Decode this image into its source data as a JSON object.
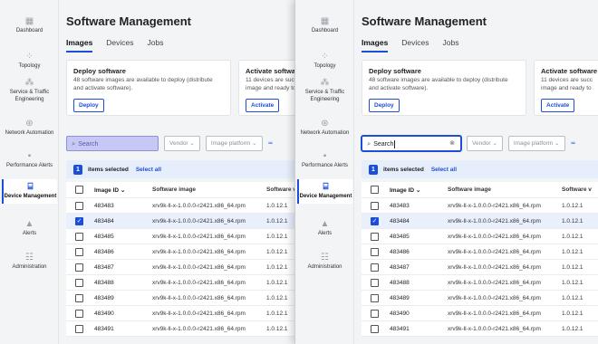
{
  "sidebar": {
    "items": [
      {
        "label": "Dashboard",
        "icon": "dashboard-icon",
        "glyph": "▦"
      },
      {
        "label": "Topology",
        "icon": "topology-icon",
        "glyph": "⁘"
      },
      {
        "label": "Service & Traffic Engineering",
        "icon": "service-icon",
        "glyph": "⁂"
      },
      {
        "label": "Network Automation",
        "icon": "automation-icon",
        "glyph": "⊛"
      },
      {
        "label": "Performance Alerts",
        "icon": "performance-icon",
        "glyph": "▪"
      },
      {
        "label": "Device Management",
        "icon": "device-icon",
        "glyph": "⌸"
      },
      {
        "label": "Alerts",
        "icon": "bell-icon",
        "glyph": "▲"
      },
      {
        "label": "Administration",
        "icon": "admin-icon",
        "glyph": "☷"
      }
    ]
  },
  "page": {
    "title": "Software Management"
  },
  "tabs": [
    {
      "label": "Images"
    },
    {
      "label": "Devices"
    },
    {
      "label": "Jobs"
    }
  ],
  "cards": {
    "deploy": {
      "title": "Deploy software",
      "line1": "48 software images are available to deploy (distribute",
      "line2": "and activate software).",
      "button": "Deploy"
    },
    "activate": {
      "title": "Activate software",
      "line1": "11 devices are succ",
      "line2": "image and ready to",
      "button": "Activate"
    }
  },
  "filters": {
    "search_placeholder": "Search",
    "search_value": "Search",
    "vendor": "Vendor",
    "image_platform": "Image platform"
  },
  "selection": {
    "count": "1",
    "text": "items selected",
    "select_all": "Select all"
  },
  "table": {
    "headers": {
      "id": "Image ID",
      "software": "Software image",
      "version": "Software v"
    },
    "rows": [
      {
        "id": "483483",
        "software": "xrv9k-ll-x-1.0.0.0-r2421.x86_64.rpm",
        "version": "1.0.12.1",
        "checked": false
      },
      {
        "id": "483484",
        "software": "xrv9k-ll-x-1.0.0.0-r2421.x86_64.rpm",
        "version": "1.0.12.1",
        "checked": true
      },
      {
        "id": "483485",
        "software": "xrv9k-ll-x-1.0.0.0-r2421.x86_64.rpm",
        "version": "1.0.12.1",
        "checked": false
      },
      {
        "id": "483486",
        "software": "xrv9k-ll-x-1.0.0.0-r2421.x86_64.rpm",
        "version": "1.0.12.1",
        "checked": false
      },
      {
        "id": "483487",
        "software": "xrv9k-ll-x-1.0.0.0-r2421.x86_64.rpm",
        "version": "1.0.12.1",
        "checked": false
      },
      {
        "id": "483488",
        "software": "xrv9k-ll-x-1.0.0.0-r2421.x86_64.rpm",
        "version": "1.0.12.1",
        "checked": false
      },
      {
        "id": "483489",
        "software": "xrv9k-ll-x-1.0.0.0-r2421.x86_64.rpm",
        "version": "1.0.12.1",
        "checked": false
      },
      {
        "id": "483490",
        "software": "xrv9k-ll-x-1.0.0.0-r2421.x86_64.rpm",
        "version": "1.0.12.1",
        "checked": false
      },
      {
        "id": "483491",
        "software": "xrv9k-ll-x-1.0.0.0-r2421.x86_64.rpm",
        "version": "1.0.12.1",
        "checked": false
      }
    ]
  },
  "colors": {
    "accent": "#1d4ed8",
    "search_highlight": "#c7c8f5",
    "selected_row": "#e9effc"
  }
}
